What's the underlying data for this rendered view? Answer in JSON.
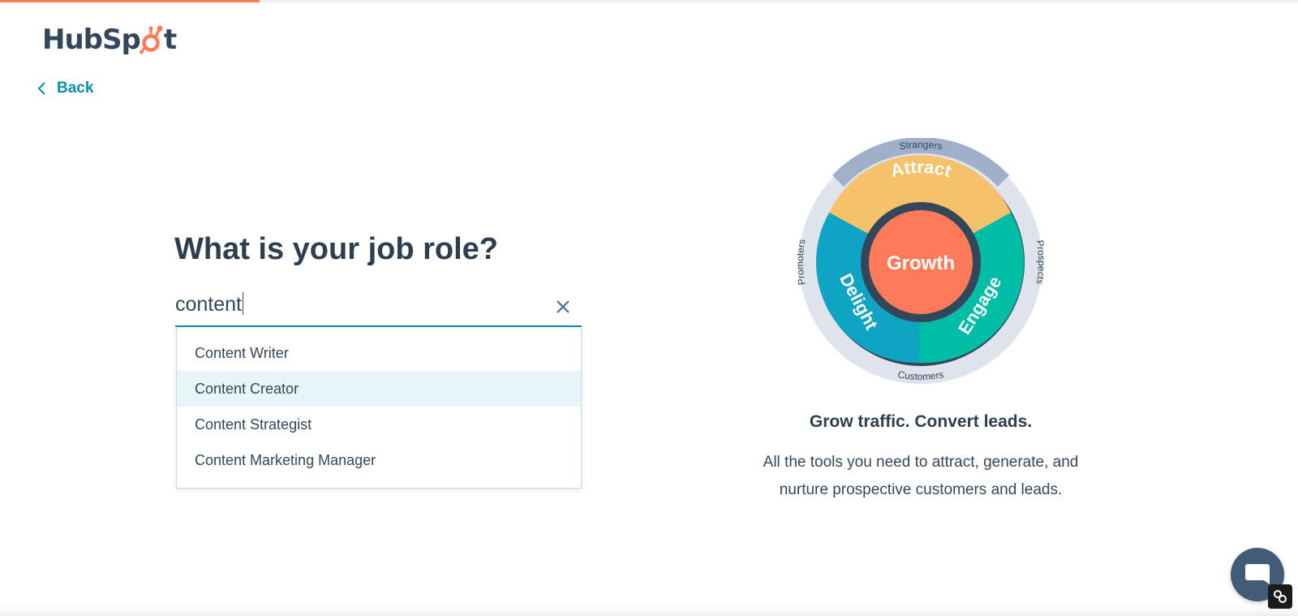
{
  "progress": {
    "fraction": 0.2,
    "fill_color": "#ff7a59"
  },
  "logo": {
    "part1": "HubSp",
    "part2": "t",
    "brand_color": "#ff7a59",
    "text_color": "#33475b"
  },
  "nav": {
    "back_label": "Back"
  },
  "form": {
    "question": "What is your job role?",
    "input_value": "content",
    "options": [
      {
        "label": "Content Writer"
      },
      {
        "label": "Content Creator"
      },
      {
        "label": "Content Strategist"
      },
      {
        "label": "Content Marketing Manager"
      }
    ],
    "highlighted_option": 1
  },
  "flywheel": {
    "center": "Growth",
    "segments": [
      "Attract",
      "Engage",
      "Delight"
    ],
    "outer_labels": [
      "Strangers",
      "Prospects",
      "Customers",
      "Promoters"
    ],
    "colors": {
      "attract": "#f5c26b",
      "engage": "#00bda5",
      "delight": "#0fa3c4",
      "growth": "#ff7a59",
      "ring": "#33475b",
      "outer": "#cbd6e2"
    }
  },
  "promo": {
    "tagline": "Grow traffic. Convert leads.",
    "description_line1": "All the tools you need to attract, generate, and",
    "description_line2": "nurture prospective customers and leads."
  },
  "icons": {
    "back": "chevron-left-icon",
    "clear": "close-icon",
    "chat": "chat-bubble-icon",
    "badge": "link-icon"
  }
}
